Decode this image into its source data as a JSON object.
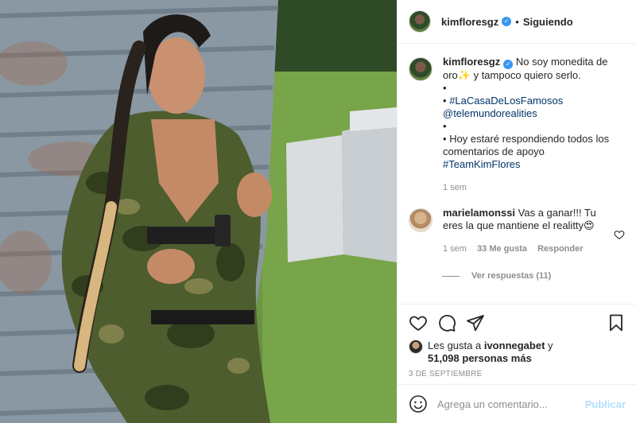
{
  "header": {
    "username": "kimfloresgz",
    "separator": "•",
    "follow_status": "Siguiendo"
  },
  "caption": {
    "username": "kimfloresgz",
    "lines": [
      "No soy monedita de oro✨ y tampoco quiero serlo.",
      "•",
      "#LaCasaDeLosFamosos",
      "@telemundorealities",
      "•",
      "Hoy estaré respondiendo todos los comentarios de apoyo",
      "#TeamKimFlores"
    ],
    "time": "1 sem"
  },
  "comment": {
    "username": "marielamonssi",
    "text": "Vas a ganar!!! Tu eres la que mantiene el realitty😍",
    "time": "1 sem",
    "likes": "33 Me gusta",
    "reply_label": "Responder",
    "view_replies": "Ver respuestas (11)"
  },
  "likes": {
    "prefix": "Les gusta a",
    "user": "ivonnegabet",
    "conjunction": "y",
    "count": "51,098 personas más"
  },
  "date": "3 de septiembre",
  "add_comment": {
    "placeholder": "Agrega un comentario...",
    "post_label": "Publicar"
  },
  "icons": [
    "heart-icon",
    "comment-icon",
    "share-icon",
    "bookmark-icon",
    "emoji-icon",
    "verified-icon"
  ],
  "colors": {
    "verified": "#3897f0",
    "link": "#003569",
    "post_disabled": "#b2dffc",
    "muted": "#8e8e8e"
  }
}
